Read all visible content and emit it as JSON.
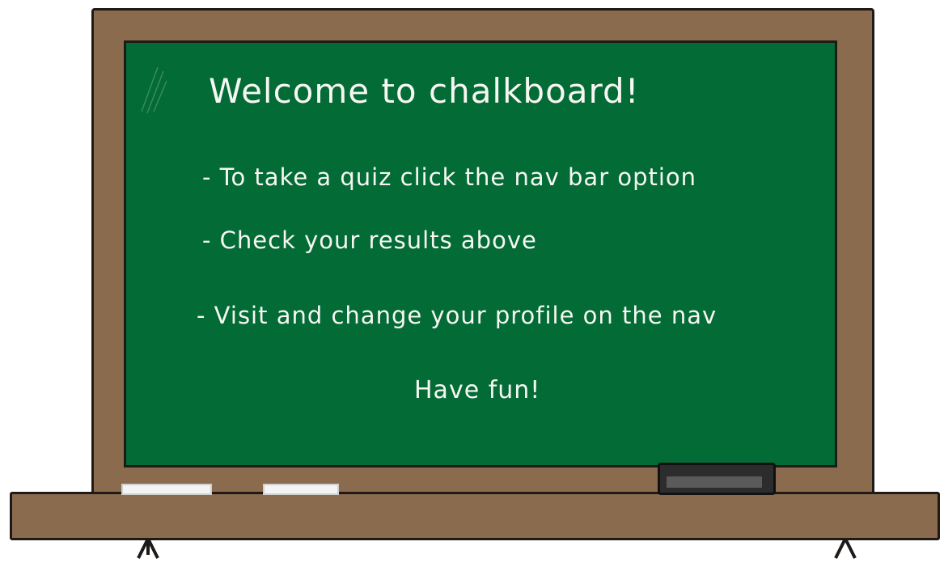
{
  "board": {
    "title": "Welcome to chalkboard!",
    "lines": [
      "- To take a quiz click the nav bar option",
      "- Check your results above",
      "- Visit and change your profile on the nav"
    ],
    "closing": "Have fun!"
  },
  "colors": {
    "board": "#026b36",
    "frame": "#8b6b4e",
    "chalk": "#f7f7f2"
  }
}
